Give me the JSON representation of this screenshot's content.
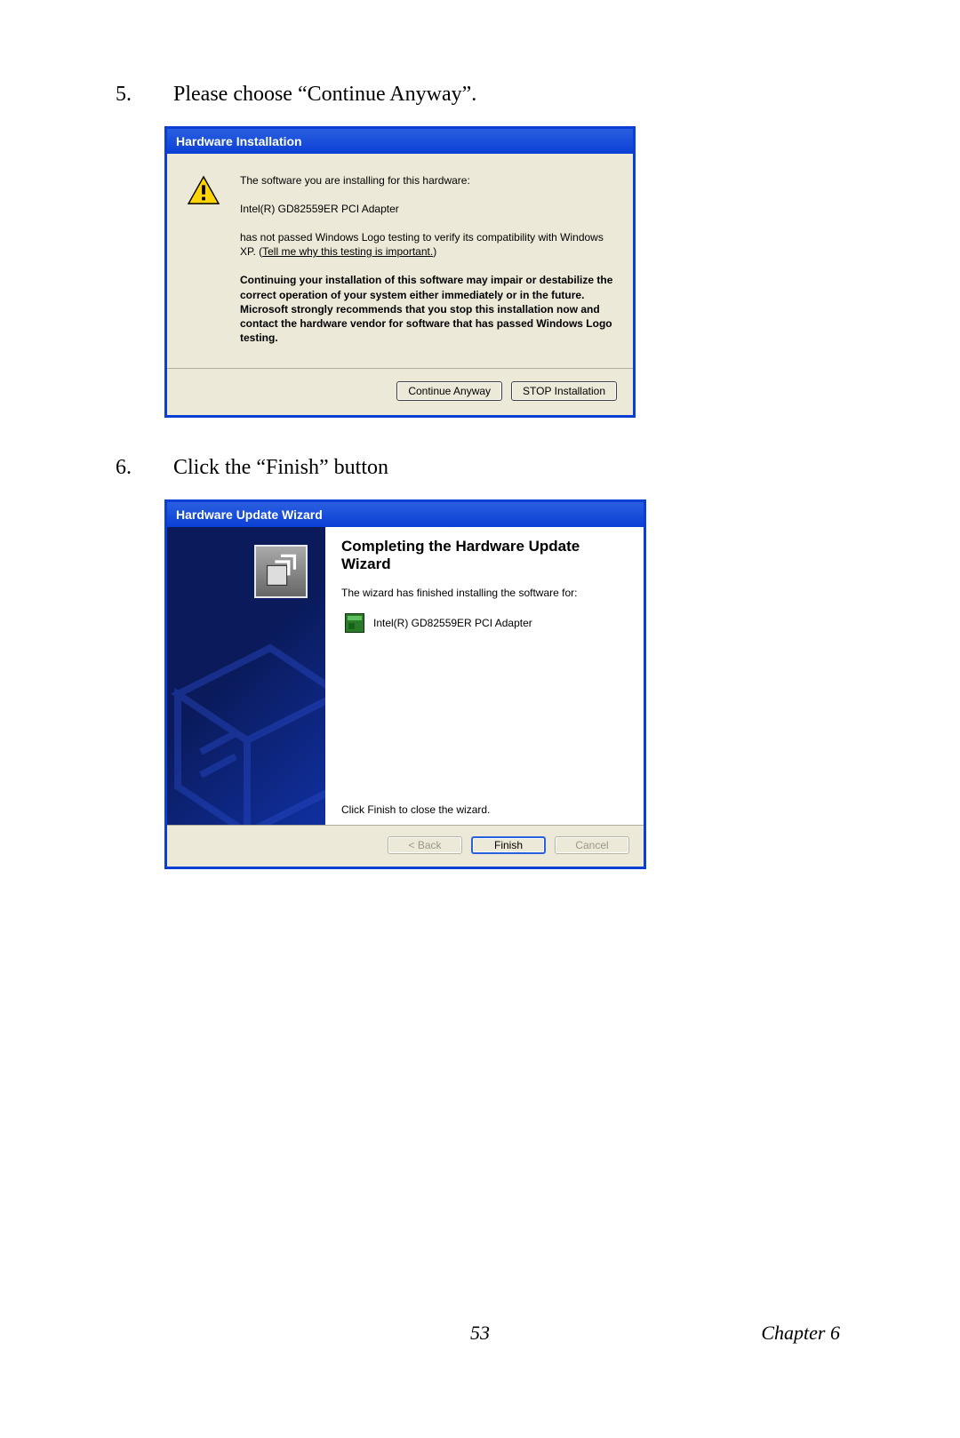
{
  "steps": {
    "s5": {
      "num": "5.",
      "text": "Please choose “Continue Anyway”."
    },
    "s6": {
      "num": "6.",
      "text": "Click the “Finish” button"
    }
  },
  "dlg1": {
    "title": "Hardware Installation",
    "line1": "The software you are installing for this hardware:",
    "device": "Intel(R) GD82559ER PCI Adapter",
    "line2a": "has not passed Windows Logo testing to verify its compatibility with Windows XP. (",
    "link": "Tell me why this testing is important.",
    "line2b": ")",
    "warn": "Continuing your installation of this software may impair or destabilize the correct operation of your system either immediately or in the future. Microsoft strongly recommends that you stop this installation now and contact the hardware vendor for software that has passed Windows Logo testing.",
    "btn_continue": "Continue Anyway",
    "btn_stop": "STOP Installation"
  },
  "dlg2": {
    "title": "Hardware Update Wizard",
    "heading": "Completing the Hardware Update Wizard",
    "desc": "The wizard has finished installing the software for:",
    "device": "Intel(R) GD82559ER PCI Adapter",
    "close_hint": "Click Finish to close the wizard.",
    "btn_back": "< Back",
    "btn_finish": "Finish",
    "btn_cancel": "Cancel"
  },
  "footer": {
    "page": "53",
    "chapter": "Chapter 6"
  }
}
